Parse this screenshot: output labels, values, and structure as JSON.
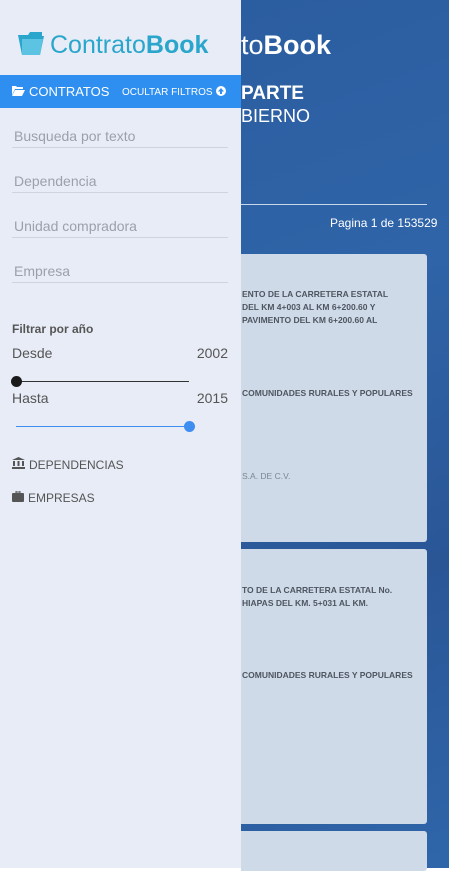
{
  "background": {
    "title_light": "to",
    "title_bold": "Book",
    "subtitle_1": "PARTE",
    "subtitle_2": "BIERNO",
    "pagination": "Pagina 1 de 153529",
    "cards": [
      {
        "lines": "ENTO DE LA CARRETERA ESTATAL\nDEL KM 4+003 AL KM 6+200.60 Y\nPAVIMENTO DEL KM 6+200.60 AL",
        "lines_2": "COMUNIDADES RURALES Y POPULARES",
        "supplier": "S.A. DE C.V."
      },
      {
        "lines": "TO DE LA CARRETERA ESTATAL No.\nHIAPAS DEL KM. 5+031 AL KM.",
        "lines_2": "COMUNIDADES RURALES Y POPULARES"
      }
    ]
  },
  "drawer": {
    "logo_light": "Contrato",
    "logo_bold": "Book",
    "tab_contratos": "CONTRATOS",
    "toggle_filters": "OCULTAR FILTROS",
    "filters": {
      "search_placeholder": "Busqueda por texto",
      "dependencia_placeholder": "Dependencia",
      "unidad_placeholder": "Unidad compradora",
      "empresa_placeholder": "Empresa"
    },
    "year_filter": {
      "title": "Filtrar por año",
      "from_label": "Desde",
      "from_value": "2002",
      "to_label": "Hasta",
      "to_value": "2015",
      "from_fraction": 0.0,
      "to_fraction": 1.0
    },
    "sections": {
      "dependencias": "DEPENDENCIAS",
      "empresas": "EMPRESAS"
    }
  },
  "colors": {
    "accent": "#2f8ff0",
    "logo": "#2aa6cc",
    "drawer_bg": "#e8ecf6",
    "page_bg": "#2a5c9e"
  }
}
